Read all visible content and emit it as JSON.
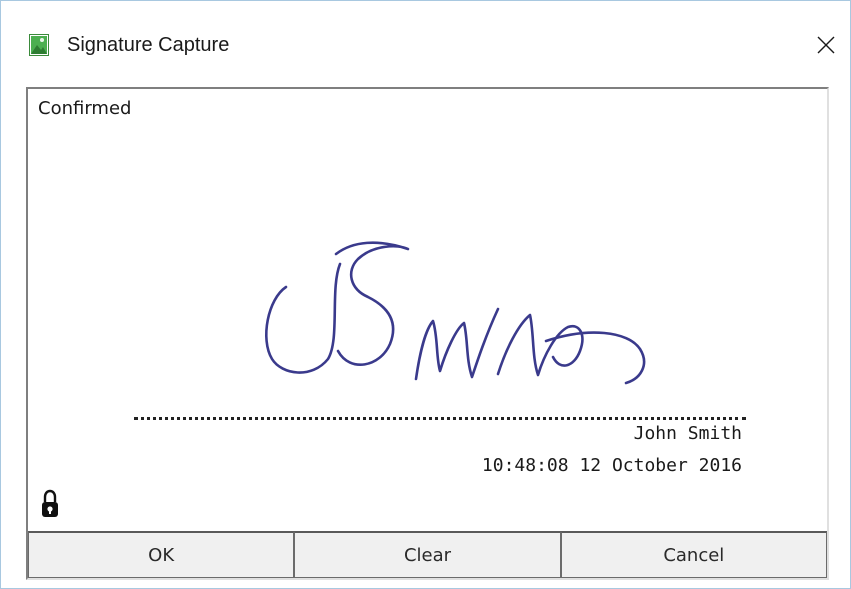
{
  "window": {
    "title": "Signature Capture"
  },
  "pad": {
    "status": "Confirmed",
    "signer_name": "John Smith",
    "timestamp": "10:48:08 12 October 2016",
    "ink_color": "#3a3a8c"
  },
  "buttons": {
    "ok_label": "OK",
    "clear_label": "Clear",
    "cancel_label": "Cancel"
  },
  "icons": {
    "app": "image-icon",
    "close": "close-icon",
    "lock": "lock-icon"
  }
}
